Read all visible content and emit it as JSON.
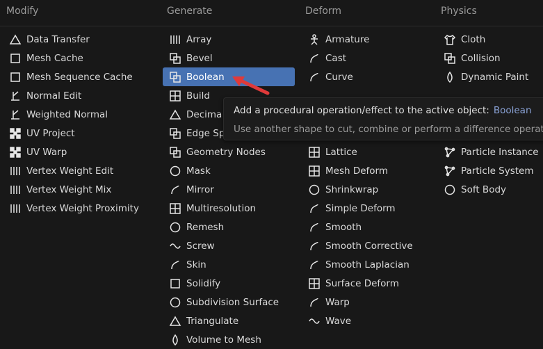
{
  "headers": {
    "modify": "Modify",
    "generate": "Generate",
    "deform": "Deform",
    "physics": "Physics"
  },
  "modify": [
    {
      "label": "Data Transfer",
      "icon": "data-transfer-icon"
    },
    {
      "label": "Mesh Cache",
      "icon": "mesh-cache-icon"
    },
    {
      "label": "Mesh Sequence Cache",
      "icon": "mesh-sequence-cache-icon"
    },
    {
      "label": "Normal Edit",
      "icon": "normal-edit-icon"
    },
    {
      "label": "Weighted Normal",
      "icon": "weighted-normal-icon"
    },
    {
      "label": "UV Project",
      "icon": "uv-project-icon"
    },
    {
      "label": "UV Warp",
      "icon": "uv-warp-icon"
    },
    {
      "label": "Vertex Weight Edit",
      "icon": "vertex-weight-edit-icon"
    },
    {
      "label": "Vertex Weight Mix",
      "icon": "vertex-weight-mix-icon"
    },
    {
      "label": "Vertex Weight Proximity",
      "icon": "vertex-weight-proximity-icon"
    }
  ],
  "generate": [
    {
      "label": "Array",
      "icon": "array-icon"
    },
    {
      "label": "Bevel",
      "icon": "bevel-icon"
    },
    {
      "label": "Boolean",
      "icon": "boolean-icon"
    },
    {
      "label": "Build",
      "icon": "build-icon"
    },
    {
      "label": "Decima",
      "icon": "decimate-icon"
    },
    {
      "label": "Edge Sp",
      "icon": "edge-split-icon"
    },
    {
      "label": "Geometry Nodes",
      "icon": "geometry-nodes-icon"
    },
    {
      "label": "Mask",
      "icon": "mask-icon"
    },
    {
      "label": "Mirror",
      "icon": "mirror-icon"
    },
    {
      "label": "Multiresolution",
      "icon": "multiresolution-icon"
    },
    {
      "label": "Remesh",
      "icon": "remesh-icon"
    },
    {
      "label": "Screw",
      "icon": "screw-icon"
    },
    {
      "label": "Skin",
      "icon": "skin-icon"
    },
    {
      "label": "Solidify",
      "icon": "solidify-icon"
    },
    {
      "label": "Subdivision Surface",
      "icon": "subdivision-surface-icon"
    },
    {
      "label": "Triangulate",
      "icon": "triangulate-icon"
    },
    {
      "label": "Volume to Mesh",
      "icon": "volume-to-mesh-icon"
    }
  ],
  "deform_top": [
    {
      "label": "Armature",
      "icon": "armature-icon"
    },
    {
      "label": "Cast",
      "icon": "cast-icon"
    },
    {
      "label": "Curve",
      "icon": "curve-icon"
    }
  ],
  "deform_bottom": [
    {
      "label": "Lattice",
      "icon": "lattice-icon"
    },
    {
      "label": "Mesh Deform",
      "icon": "mesh-deform-icon"
    },
    {
      "label": "Shrinkwrap",
      "icon": "shrinkwrap-icon"
    },
    {
      "label": "Simple Deform",
      "icon": "simple-deform-icon"
    },
    {
      "label": "Smooth",
      "icon": "smooth-icon"
    },
    {
      "label": "Smooth Corrective",
      "icon": "smooth-corrective-icon"
    },
    {
      "label": "Smooth Laplacian",
      "icon": "smooth-laplacian-icon"
    },
    {
      "label": "Surface Deform",
      "icon": "surface-deform-icon"
    },
    {
      "label": "Warp",
      "icon": "warp-icon"
    },
    {
      "label": "Wave",
      "icon": "wave-icon"
    }
  ],
  "physics_top": [
    {
      "label": "Cloth",
      "icon": "cloth-icon"
    },
    {
      "label": "Collision",
      "icon": "collision-icon"
    },
    {
      "label": "Dynamic Paint",
      "icon": "dynamic-paint-icon"
    }
  ],
  "physics_bottom": [
    {
      "label": "Particle Instance",
      "icon": "particle-instance-icon"
    },
    {
      "label": "Particle System",
      "icon": "particle-system-icon"
    },
    {
      "label": "Soft Body",
      "icon": "soft-body-icon"
    }
  ],
  "tooltip": {
    "line1": "Add a procedural operation/effect to the active object:",
    "keyword": "Boolean",
    "line2": "Use another shape to cut, combine or perform a difference operation"
  },
  "colors": {
    "accent": "#4772b3",
    "arrow": "#e03a3a",
    "background": "#181818"
  }
}
